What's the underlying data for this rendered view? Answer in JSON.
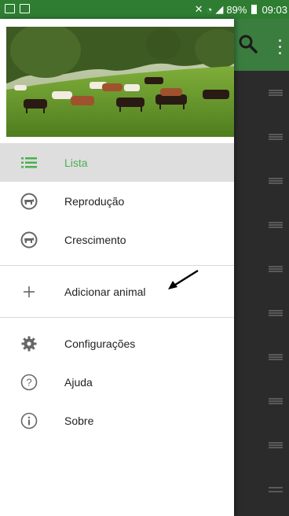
{
  "status_bar": {
    "battery": "89%",
    "time": "09:03"
  },
  "colors": {
    "primary": "#2e7d32",
    "accent": "#4caf50",
    "selected_bg": "#dedede"
  },
  "header": {
    "image": "cows-in-pasture"
  },
  "drawer": {
    "items": [
      {
        "label": "Lista",
        "icon": "list-icon",
        "selected": true
      },
      {
        "label": "Reprodução",
        "icon": "cow-icon",
        "selected": false
      },
      {
        "label": "Crescimento",
        "icon": "cow-icon",
        "selected": false
      },
      {
        "label": "Adicionar animal",
        "icon": "plus-icon",
        "selected": false
      },
      {
        "label": "Configurações",
        "icon": "gear-icon",
        "selected": false
      },
      {
        "label": "Ajuda",
        "icon": "help-icon",
        "selected": false
      },
      {
        "label": "Sobre",
        "icon": "info-icon",
        "selected": false
      }
    ]
  },
  "background_app": {
    "icons": [
      "search-icon",
      "more-vert-icon",
      "drag-handle-icon"
    ]
  }
}
